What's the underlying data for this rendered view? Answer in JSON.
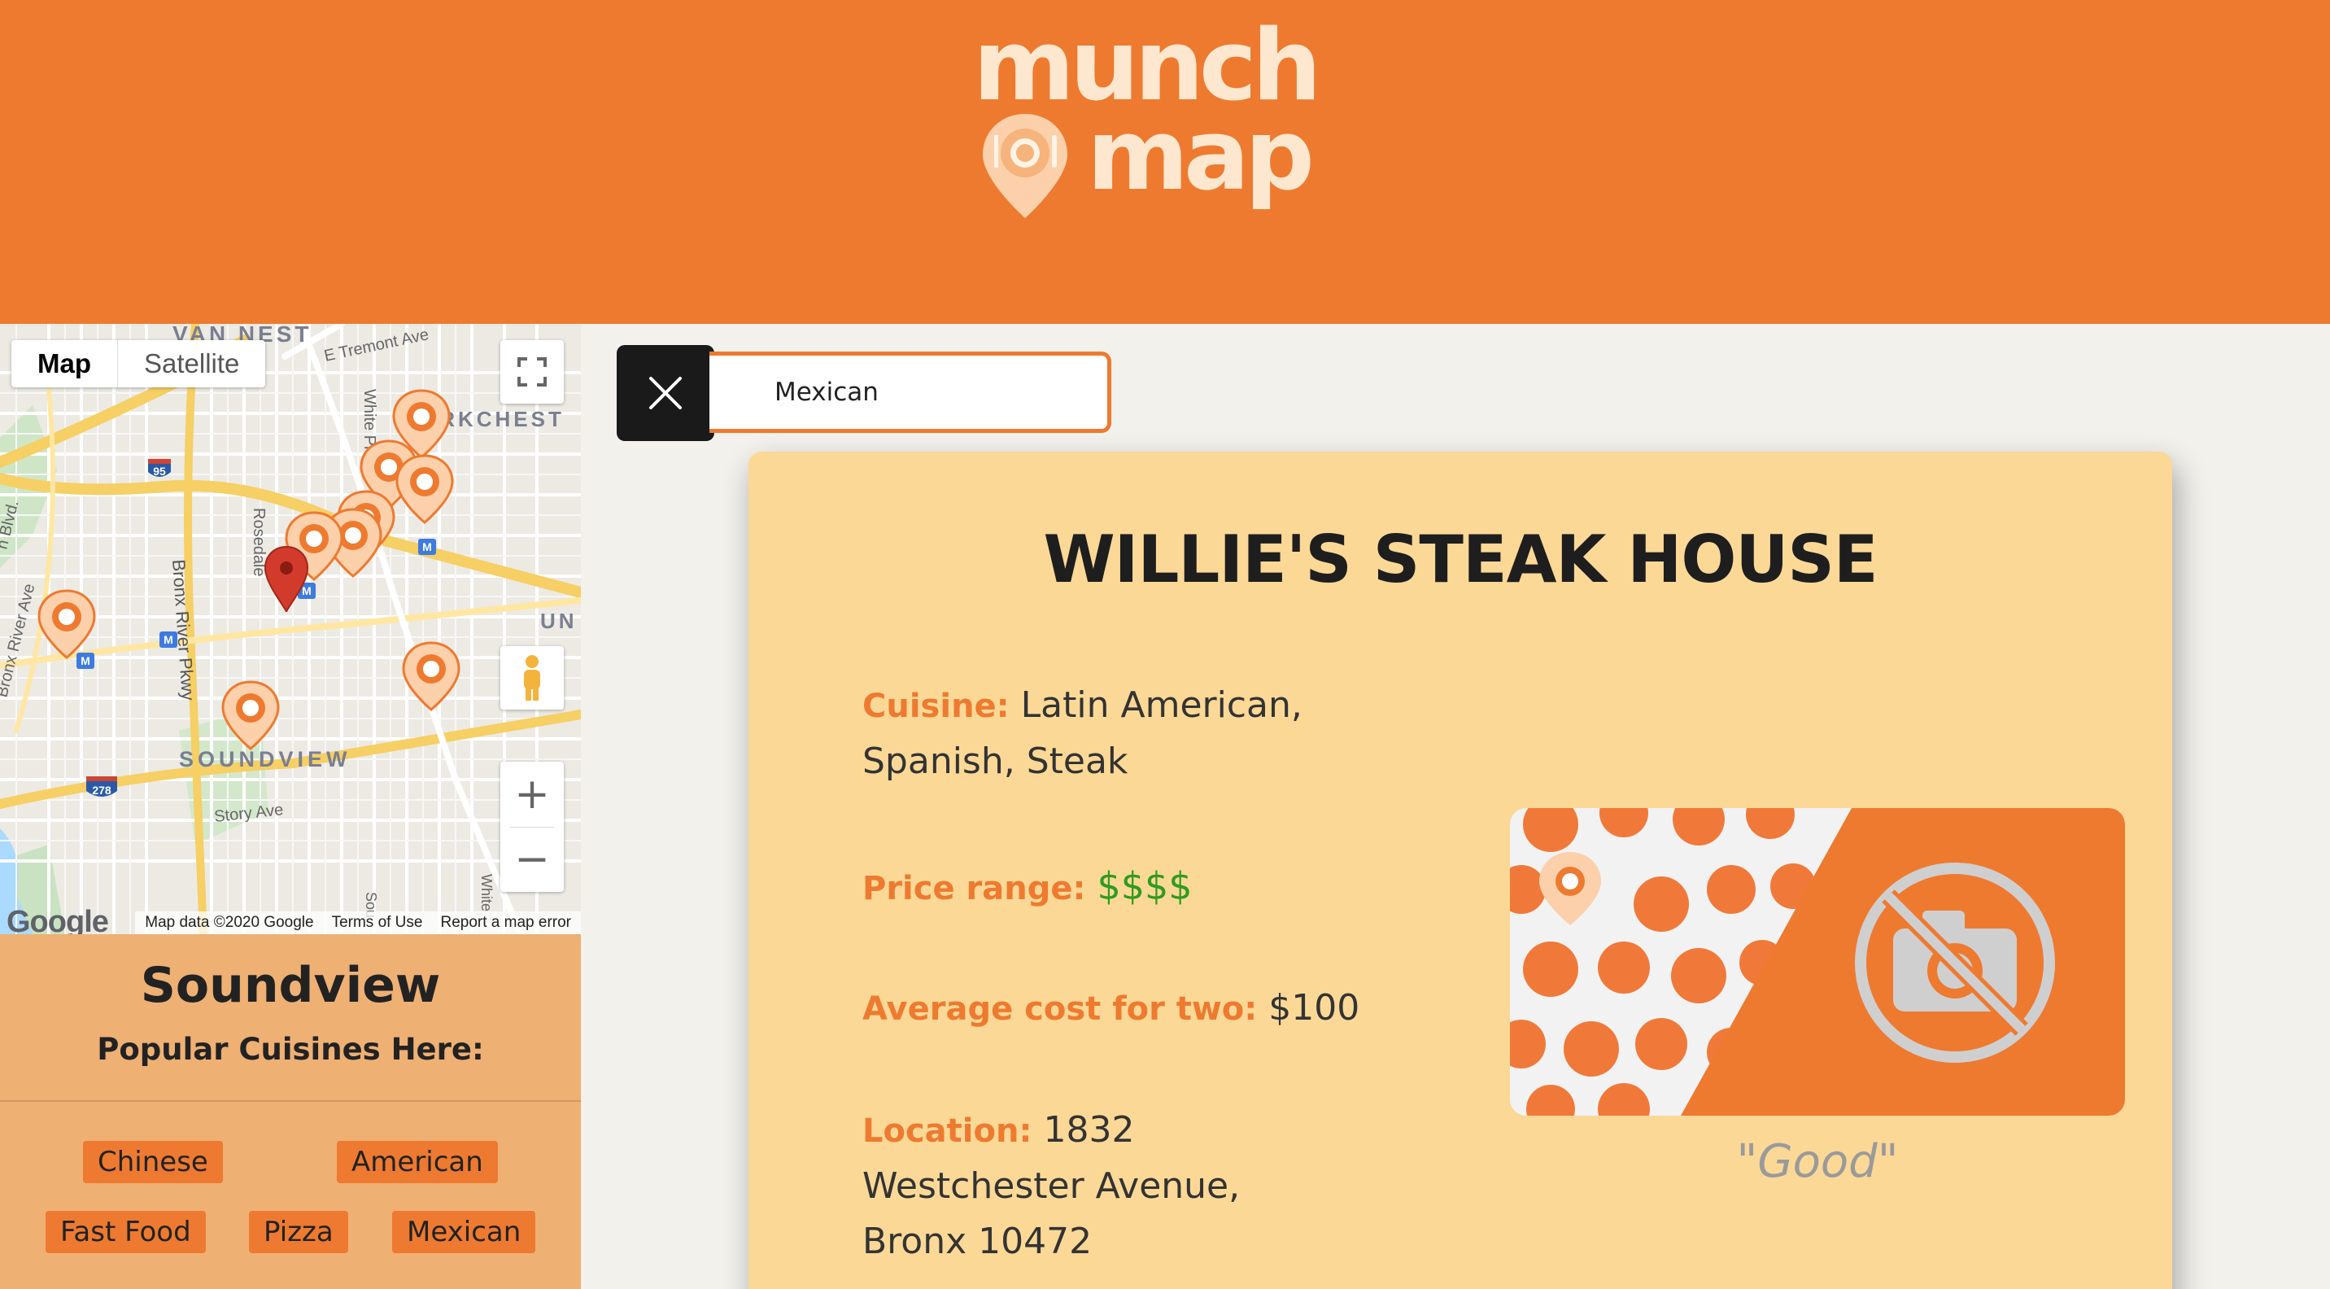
{
  "header": {
    "logo_top": "munch",
    "logo_bottom": "map"
  },
  "map": {
    "tabs": [
      "Map",
      "Satellite"
    ],
    "labels": {
      "van_nest": "VAN NEST",
      "e_tremont": "E Tremont Ave",
      "parkchester": "PARKCHEST",
      "white_plains": "White Pl",
      "rosedale": "Rosedale",
      "bronx_river_pkwy": "Bronx River Pkwy",
      "bronx_river_ave": "Bronx River Ave",
      "blvd": "n Blvd.",
      "soundview": "SOUNDVIEW",
      "story_ave": "Story Ave",
      "un": "UN",
      "white": "White",
      "sou": "Sou",
      "shield_95": "95",
      "shield_278": "278",
      "metro": "M"
    },
    "zoom_in": "+",
    "zoom_out": "−",
    "google": "Google",
    "attribution": [
      "Map data ©2020 Google",
      "Terms of Use",
      "Report a map error"
    ]
  },
  "neighborhood": {
    "name": "Soundview",
    "subtitle": "Popular Cuisines Here:",
    "cuisines": [
      "Chinese",
      "American",
      "Fast Food",
      "Pizza",
      "Mexican"
    ]
  },
  "search": {
    "value": "Mexican"
  },
  "restaurant": {
    "name": "WILLIE'S STEAK HOUSE",
    "cuisine_label": "Cuisine:",
    "cuisine_value": "Latin American, Spanish, Steak",
    "price_label": "Price range:",
    "price_value": "$$$$",
    "cost_label": "Average cost for two:",
    "cost_value": "$100",
    "location_label": "Location:",
    "location_value": "1832 Westchester Avenue, Bronx 10472",
    "review": "\"Good\""
  },
  "colors": {
    "brand_orange": "#ee7a30",
    "card_bg": "#fbd896",
    "panel_bg": "#efb074",
    "price_green": "#2f9b1f"
  }
}
